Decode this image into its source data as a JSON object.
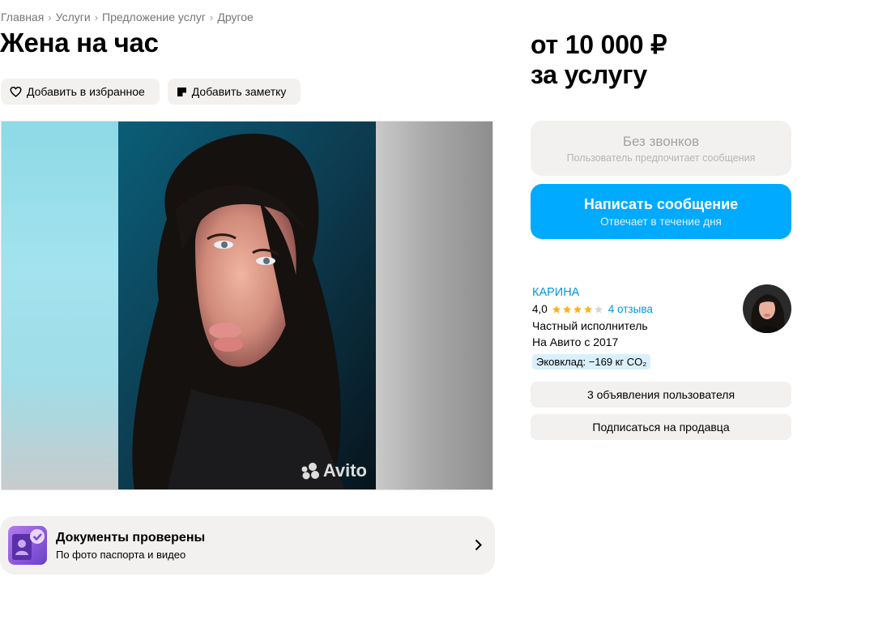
{
  "breadcrumbs": [
    "Главная",
    "Услуги",
    "Предложение услуг",
    "Другое"
  ],
  "title": "Жена на час",
  "actions": {
    "favorite_label": "Добавить в избранное",
    "note_label": "Добавить заметку"
  },
  "gallery": {
    "watermark": "Avito"
  },
  "documents": {
    "title": "Документы проверены",
    "subtitle": "По фото паспорта и видео"
  },
  "price": {
    "line1": "от 10 000 ₽",
    "line2": "за услугу"
  },
  "no_calls": {
    "title": "Без звонков",
    "subtitle": "Пользователь предпочитает сообщения"
  },
  "message_button": {
    "title": "Написать сообщение",
    "subtitle": "Отвечает в течение дня"
  },
  "seller": {
    "name": "КАРИНА",
    "rating": "4,0",
    "rating_value": 4,
    "rating_max": 5,
    "reviews": "4 отзыва",
    "type": "Частный исполнитель",
    "since": "На Авито с 2017",
    "eco": "Эковклад: −169 кг CO₂"
  },
  "seller_buttons": {
    "ads": "3 объявления пользователя",
    "subscribe": "Подписаться на продавца"
  },
  "colors": {
    "accent": "#00aaff",
    "link": "#0096e6",
    "star": "#ffb021",
    "surface": "#f2f1f0"
  }
}
